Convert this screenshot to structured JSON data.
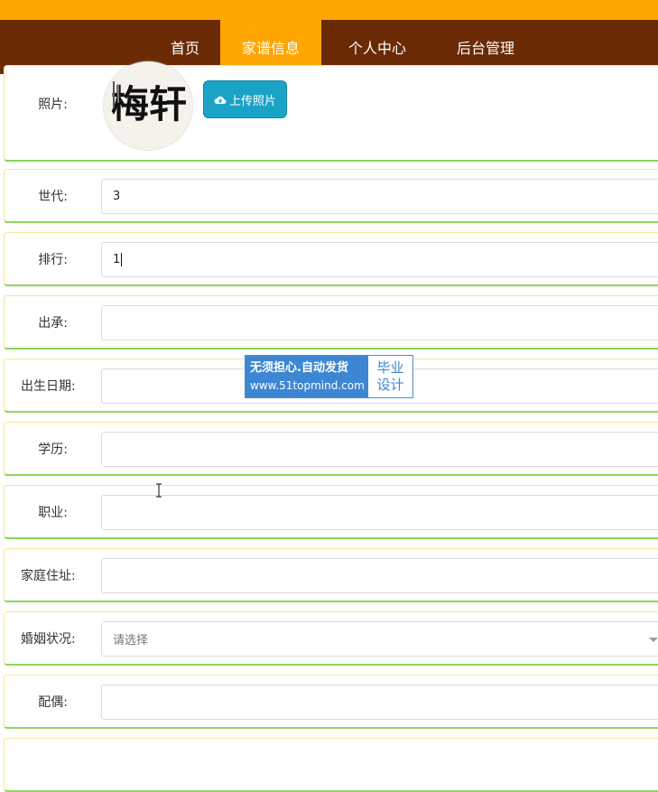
{
  "colors": {
    "top_bar": "#ffa500",
    "nav_bg": "#6a2a04",
    "nav_active": "#ffa500",
    "upload_button": "#1aa3c6",
    "row_border": "#8ed65a"
  },
  "nav": {
    "items": [
      {
        "label": "首页"
      },
      {
        "label": "家谱信息"
      },
      {
        "label": "个人中心"
      },
      {
        "label": "后台管理"
      }
    ],
    "active": "家谱信息"
  },
  "form": {
    "photo_label": "照片:",
    "avatar_text": "梅轩",
    "upload_label": "上传照片",
    "generation_label": "世代:",
    "generation_value": "3",
    "rank_label": "排行:",
    "rank_value": "1",
    "origin_label": "出承:",
    "origin_value": "",
    "birthdate_label": "出生日期:",
    "birthdate_value": "",
    "education_label": "学历:",
    "education_value": "",
    "occupation_label": "职业:",
    "occupation_value": "",
    "address_label": "家庭住址:",
    "address_value": "",
    "marital_label": "婚姻状况:",
    "marital_value": "请选择",
    "spouse_label": "配偶:",
    "spouse_value": ""
  },
  "watermark": {
    "line1": "无须担心.自动发货",
    "line2": "www.51topmind.com",
    "right1": "毕业",
    "right2": "设计"
  }
}
